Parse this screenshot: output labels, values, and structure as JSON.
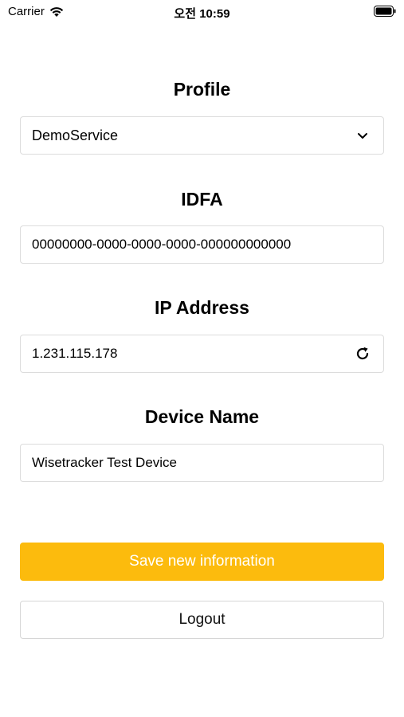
{
  "status_bar": {
    "carrier": "Carrier",
    "time": "오전 10:59",
    "icons": [
      "wifi-icon",
      "battery-icon"
    ]
  },
  "form": {
    "profile": {
      "title": "Profile",
      "selected": "DemoService",
      "icon": "chevron-down-icon"
    },
    "idfa": {
      "title": "IDFA",
      "value": "00000000-0000-0000-0000-000000000000"
    },
    "ip_address": {
      "title": "IP Address",
      "value": "1.231.115.178",
      "icon": "refresh-icon"
    },
    "device_name": {
      "title": "Device Name",
      "value": "Wisetracker Test Device"
    }
  },
  "actions": {
    "save_label": "Save new information",
    "logout_label": "Logout"
  },
  "colors": {
    "accent": "#fcbb0d",
    "field_border": "#dcdcdc",
    "background": "#ffffff"
  }
}
